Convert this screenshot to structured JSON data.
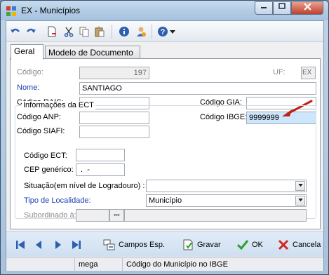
{
  "window": {
    "title": "EX - Municípios"
  },
  "tabs": [
    {
      "label": "Geral"
    },
    {
      "label": "Modelo de Documento"
    }
  ],
  "form": {
    "codigo": {
      "label": "Código:",
      "value": "197"
    },
    "uf": {
      "label": "UF:",
      "value": "EX"
    },
    "nome": {
      "label": "Nome:",
      "value": "SANTIAGO"
    },
    "codigo_rais": {
      "label": "Código RAIS:",
      "value": ""
    },
    "codigo_anp": {
      "label": "Código ANP:",
      "value": ""
    },
    "codigo_siafi": {
      "label": "Código SIAFI:",
      "value": ""
    },
    "codigo_gia": {
      "label": "Código GIA:",
      "value": ""
    },
    "codigo_ibge": {
      "label": "Código IBGE:",
      "value": "9999999"
    }
  },
  "ect": {
    "title": "Informações da ECT",
    "codigo_ect": {
      "label": "Código ECT:",
      "value": ""
    },
    "cep_generico": {
      "label": "CEP genérico:",
      "value": " .  -"
    },
    "situacao": {
      "label": "Situação(em nível de Logradouro) :",
      "value": ""
    },
    "tipo_localidade": {
      "label": "Tipo de Localidade:",
      "value": "Município"
    },
    "subordinado": {
      "label": "Subordinado à:",
      "button": "•••",
      "value": ""
    }
  },
  "actions": {
    "campos_esp": "Campos Esp.",
    "gravar": "Gravar",
    "ok": "OK",
    "cancela": "Cancela"
  },
  "status": {
    "cell1": "",
    "cell2": "mega",
    "cell3": "Código do Município no IBGE"
  },
  "colors": {
    "accent_blue": "#1a3fb0",
    "annotation_arrow": "#c0201b",
    "ok_green": "#2e9e2e",
    "cancel_red": "#d42424"
  }
}
